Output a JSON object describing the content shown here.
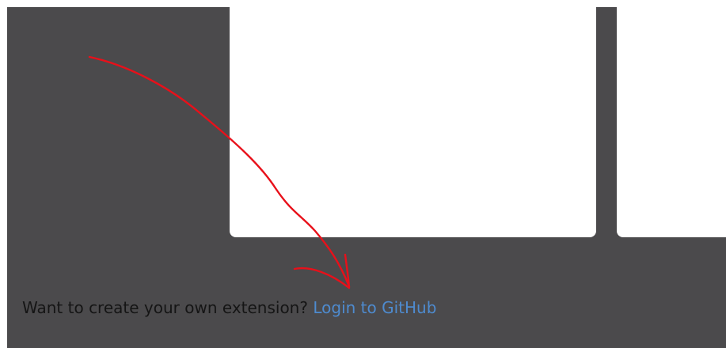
{
  "footer": {
    "prompt_text": "Want to create your own extension?",
    "link_label": "Login to GitHub"
  },
  "annotation": {
    "color": "#e8101a",
    "icon": "hand-drawn-arrow-icon"
  },
  "colors": {
    "panel_background": "#4b4a4c",
    "card_background": "#ffffff",
    "link": "#4e8bcf",
    "text": "#151515"
  }
}
